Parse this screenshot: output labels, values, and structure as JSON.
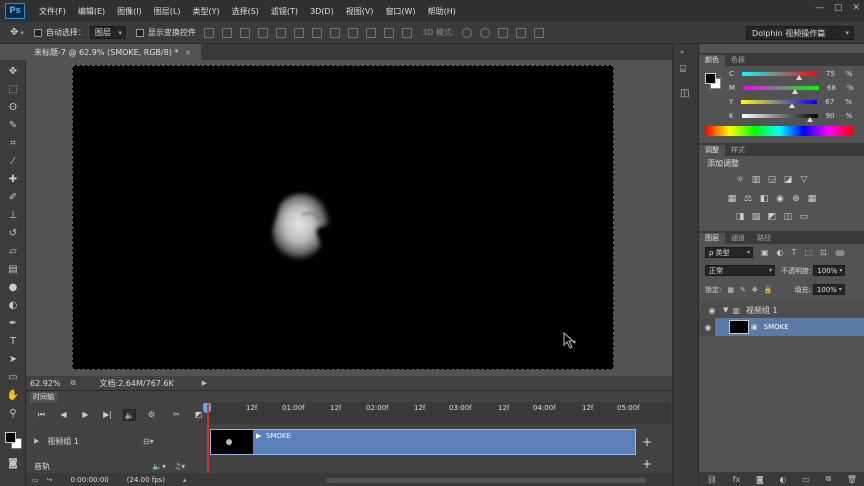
{
  "app": {
    "logo": "Ps",
    "menu": [
      "文件(F)",
      "编辑(E)",
      "图像(I)",
      "图层(L)",
      "类型(Y)",
      "选择(S)",
      "滤镜(T)",
      "3D(D)",
      "视图(V)",
      "窗口(W)",
      "帮助(H)"
    ],
    "window_controls": [
      "—",
      "□",
      "✕"
    ]
  },
  "options": {
    "auto_select_label": "自动选择：",
    "auto_select_value": "图层",
    "show_transform_label": "显示变换控件",
    "mode_3d_label": "3D 模式:",
    "workspace": "Dolphin 视频操作篇"
  },
  "document": {
    "tab_title": "未标题-7 @ 62.9% (SMOKE, RGB/8) *",
    "zoom": "62.92%",
    "doc_info": "文档:2.64M/767.6K"
  },
  "timeline": {
    "tab": "时间轴",
    "ruler_labels": [
      "12f",
      "01:00f",
      "12f",
      "02:00f",
      "12f",
      "03:00f",
      "12f",
      "04:00f",
      "12f",
      "05:00f"
    ],
    "track_name": "视频组 1",
    "clip_name": "SMOKE",
    "audio_label": "音轨",
    "timecode": "0:00:00:00",
    "fps": "(24.00 fps)"
  },
  "panels": {
    "color_tabs": [
      "颜色",
      "色板"
    ],
    "cmyk": [
      {
        "label": "C",
        "value": "75",
        "pct": 0.75,
        "grad": [
          "#00ffff",
          "#ff0000"
        ]
      },
      {
        "label": "M",
        "value": "68",
        "pct": 0.68,
        "grad": [
          "#ff00ff",
          "#00ff00"
        ]
      },
      {
        "label": "Y",
        "value": "67",
        "pct": 0.67,
        "grad": [
          "#ffff00",
          "#0000ff"
        ]
      },
      {
        "label": "K",
        "value": "90",
        "pct": 0.9,
        "grad": [
          "#ffffff",
          "#000000"
        ]
      }
    ],
    "unit": "%",
    "adjust_tabs": [
      "调整",
      "样式"
    ],
    "adjust_title": "添加调整",
    "layers_tabs": [
      "图层",
      "通道",
      "路径"
    ],
    "kind_label": "ρ 类型",
    "blend_mode": "正常",
    "opacity_label": "不透明度:",
    "opacity_value": "100%",
    "lock_label": "锁定:",
    "fill_label": "填充:",
    "fill_value": "100%",
    "group_name": "视频组 1",
    "layer_name": "SMOKE"
  }
}
